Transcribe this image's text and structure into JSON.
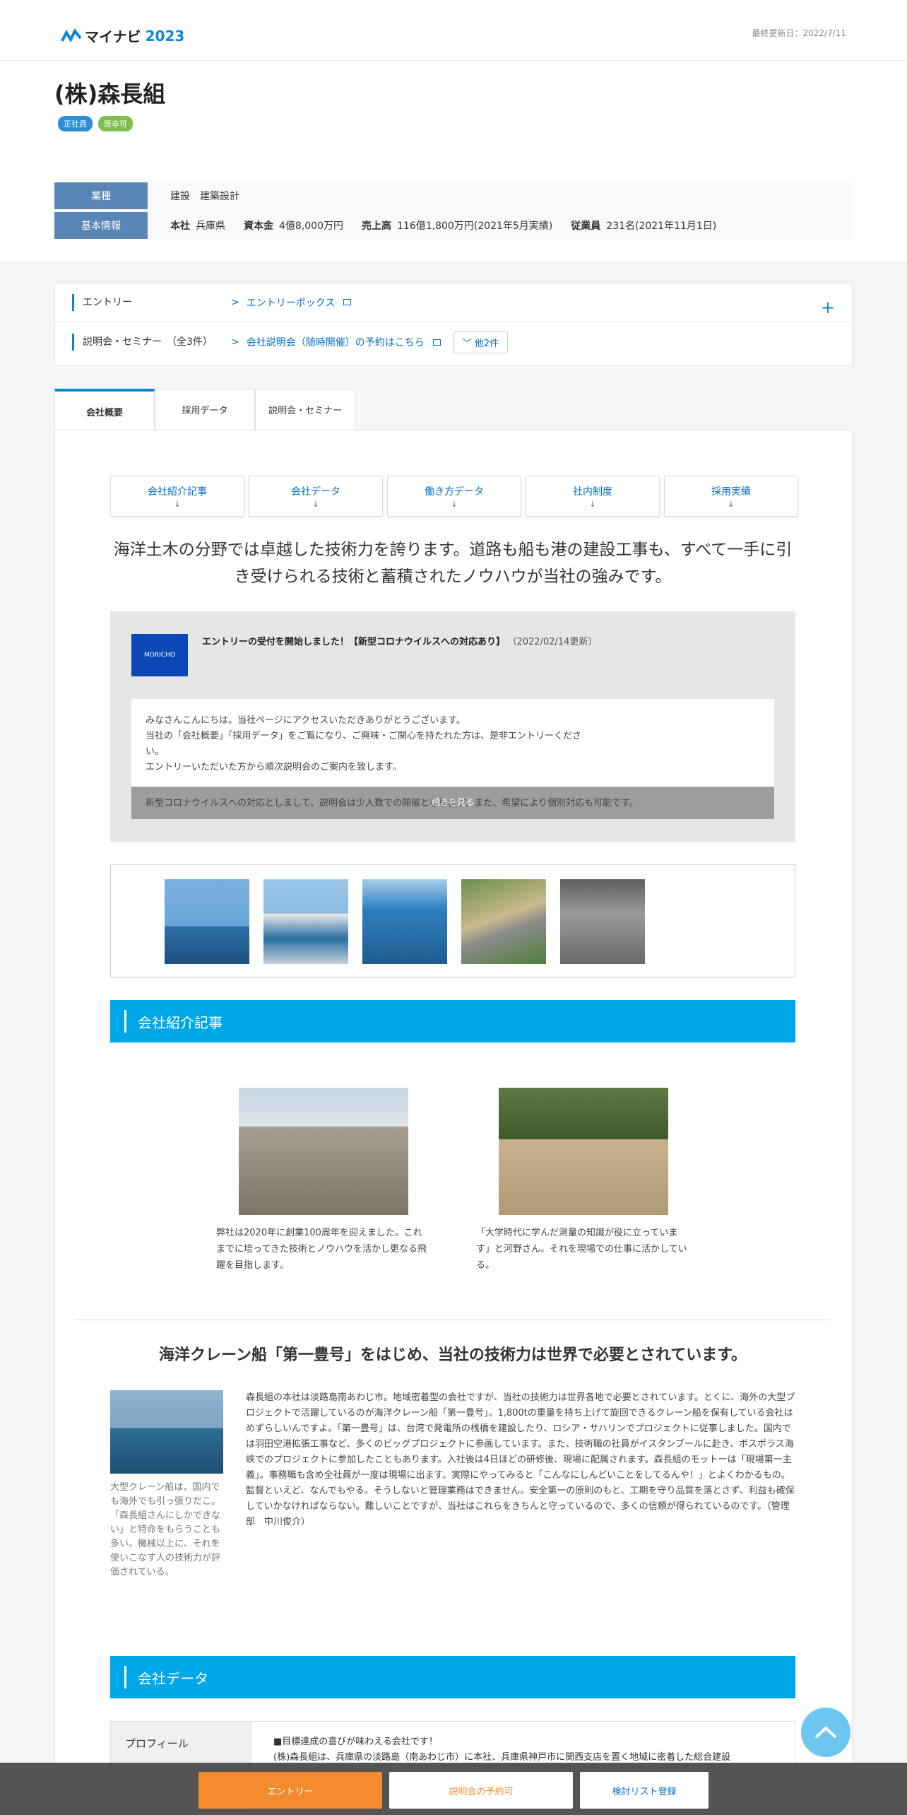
{
  "header": {
    "logo_text": "マイナビ",
    "logo_year": "2023",
    "updated": "最終更新日：2022/7/11"
  },
  "company": {
    "name": "(株)森長組",
    "badges": [
      "正社員",
      "既卒可"
    ]
  },
  "info": {
    "industry_label": "業種",
    "industry_value": "建設　建築設計",
    "basic_label": "基本情報",
    "hq_label": "本社",
    "hq": "兵庫県",
    "capital_label": "資本金",
    "capital": "4億8,000万円",
    "sales_label": "売上高",
    "sales": "116億1,800万円(2021年5月実績)",
    "employees_label": "従業員",
    "employees": "231名(2021年11月1日)"
  },
  "entry": {
    "entry_label": "エントリー",
    "entry_link": "エントリーボックス",
    "seminar_label": "説明会・セミナー　（全3件）",
    "seminar_link": "会社説明会（随時開催）の予約はこちら",
    "more": "他2件",
    "plus": "+"
  },
  "tabs": [
    "会社概要",
    "採用データ",
    "説明会・セミナー"
  ],
  "anchors": [
    "会社紹介記事",
    "会社データ",
    "働き方データ",
    "社内制度",
    "採用実績"
  ],
  "anchor_arrow": "↓",
  "catch": "海洋土木の分野では卓越した技術力を誇ります。道路も船も港の建設工事も、すべて一手に引き受けられる技術と蓄積されたノウハウが当社の強みです。",
  "message": {
    "logo_text": "MORICHO",
    "title": "エントリーの受付を開始しました！【新型コロナウイルスへの対応あり】",
    "date": "（2022/02/14更新）",
    "body": [
      "みなさんこんにちは。当社ページにアクセスいただきありがとうございます。",
      "当社の「会社概要」「採用データ」をご覧になり、ご興味・ご関心を持たれた方は、是非エントリーください。",
      "エントリーいただいた方から順次説明会のご案内を致します。"
    ],
    "fade_text": "新型コロナウイルスへの対応としまして、説明会は少人数での開催となります。また、希望により個別対応も可能です。",
    "fade_button": "続きを見る"
  },
  "section1": "会社紹介記事",
  "articles": [
    {
      "caption": "弊社は2020年に創業100周年を迎えました。これまでに培ってきた技術とノウハウを活かし更なる飛躍を目指します。"
    },
    {
      "caption": "「大学時代に学んだ測量の知識が役に立っています」と河野さん。それを現場での仕事に活かしている。"
    }
  ],
  "subheading": "海洋クレーン船「第一豊号」をはじめ、当社の技術力は世界で必要とされています。",
  "overview": {
    "caption": "大型クレーン船は、国内でも海外でも引っ張りだこ。「森長組さんにしかできない」と特命をもらうことも多い。機械以上に、それを使いこなす人の技術力が評価されている。",
    "text": "森長組の本社は淡路島南あわじ市。地域密着型の会社ですが、当社の技術力は世界各地で必要とされています。とくに、海外の大型プロジェクトで活躍しているのが海洋クレーン船「第一豊号」。1,800tの重量を持ち上げて旋回できるクレーン船を保有している会社はめずらしいんですよ。「第一豊号」は、台湾で発電所の桟橋を建設したり、ロシア・サハリンでプロジェクトに従事しました。国内では羽田空港拡張工事など、多くのビッグプロジェクトに参画しています。また、技術職の社員がイスタンブールに赴き、ボスポラス海峡でのプロジェクトに参加したこともあります。入社後は4日ほどの研修後、現場に配属されます。森長組のモットーは「現場第一主義」。事務職も含め全社員が一度は現場に出ます。実際にやってみると「こんなにしんどいことをしてるんや！」とよくわかるもの。監督といえど、なんでもやる。そうしないと管理業務はできません。安全第一の原則のもと、工期を守り品質を落とさず、利益も確保していかなければならない。難しいことですが、当社はこれらをきちんと守っているので、多くの信頼が得られているのです。（管理部　中川俊介）"
  },
  "section2": "会社データ",
  "profile": {
    "label": "プロフィール",
    "line1": "■目標達成の喜びが味わえる会社です！",
    "line2": "(株)森長組は、兵庫県の淡路島（南あわじ市）に本社、兵庫県神戸市に関西支店を置く地域に密着した総合建設"
  },
  "bottom": {
    "entry": "エントリー",
    "seminar": "説明会の予約可",
    "consider": "検討リスト登録"
  }
}
